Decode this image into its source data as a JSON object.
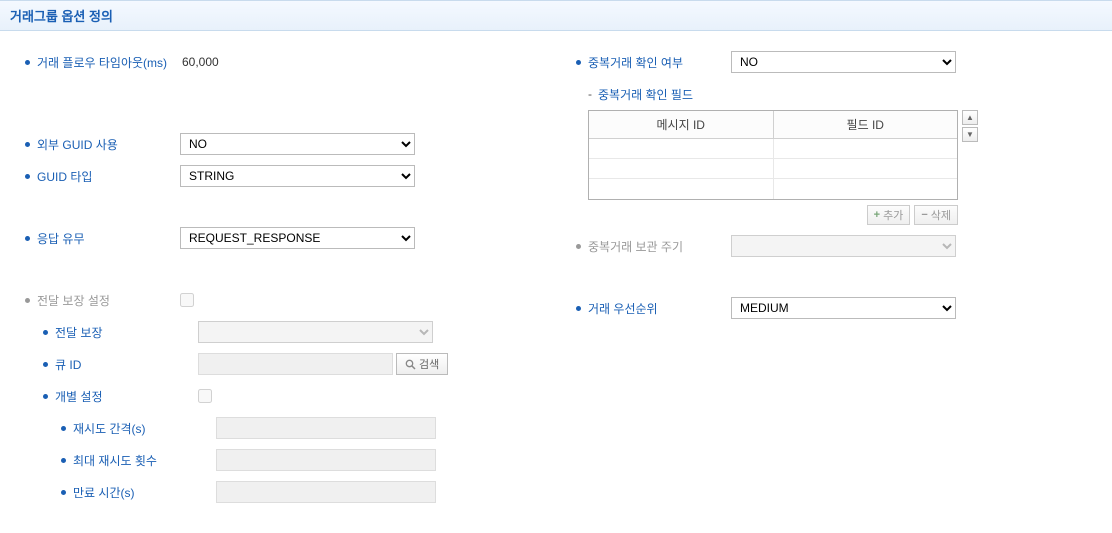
{
  "panel": {
    "title": "거래그룹 옵션 정의"
  },
  "left": {
    "flow_timeout": {
      "label": "거래 플로우 타임아웃(ms)",
      "value": "60,000"
    },
    "ext_guid": {
      "label": "외부 GUID 사용",
      "value": "NO"
    },
    "guid_type": {
      "label": "GUID 타입",
      "value": "STRING"
    },
    "response": {
      "label": "응답 유무",
      "value": "REQUEST_RESPONSE"
    },
    "delivery_setting": {
      "label": "전달 보장 설정"
    },
    "delivery": {
      "label": "전달 보장"
    },
    "queue_id": {
      "label": "큐 ID",
      "search": "검색"
    },
    "indiv_setting": {
      "label": "개별 설정"
    },
    "retry_interval": {
      "label": "재시도 간격(s)"
    },
    "max_retry": {
      "label": "최대 재시도 횟수"
    },
    "expire": {
      "label": "만료 시간(s)"
    }
  },
  "right": {
    "dup_check": {
      "label": "중복거래 확인 여부",
      "value": "NO"
    },
    "dup_field": {
      "label": "중복거래 확인 필드"
    },
    "table": {
      "col1": "메시지 ID",
      "col2": "필드 ID"
    },
    "buttons": {
      "add": "추가",
      "delete": "삭제"
    },
    "dup_period": {
      "label": "중복거래 보관 주기"
    },
    "priority": {
      "label": "거래 우선순위",
      "value": "MEDIUM"
    }
  }
}
